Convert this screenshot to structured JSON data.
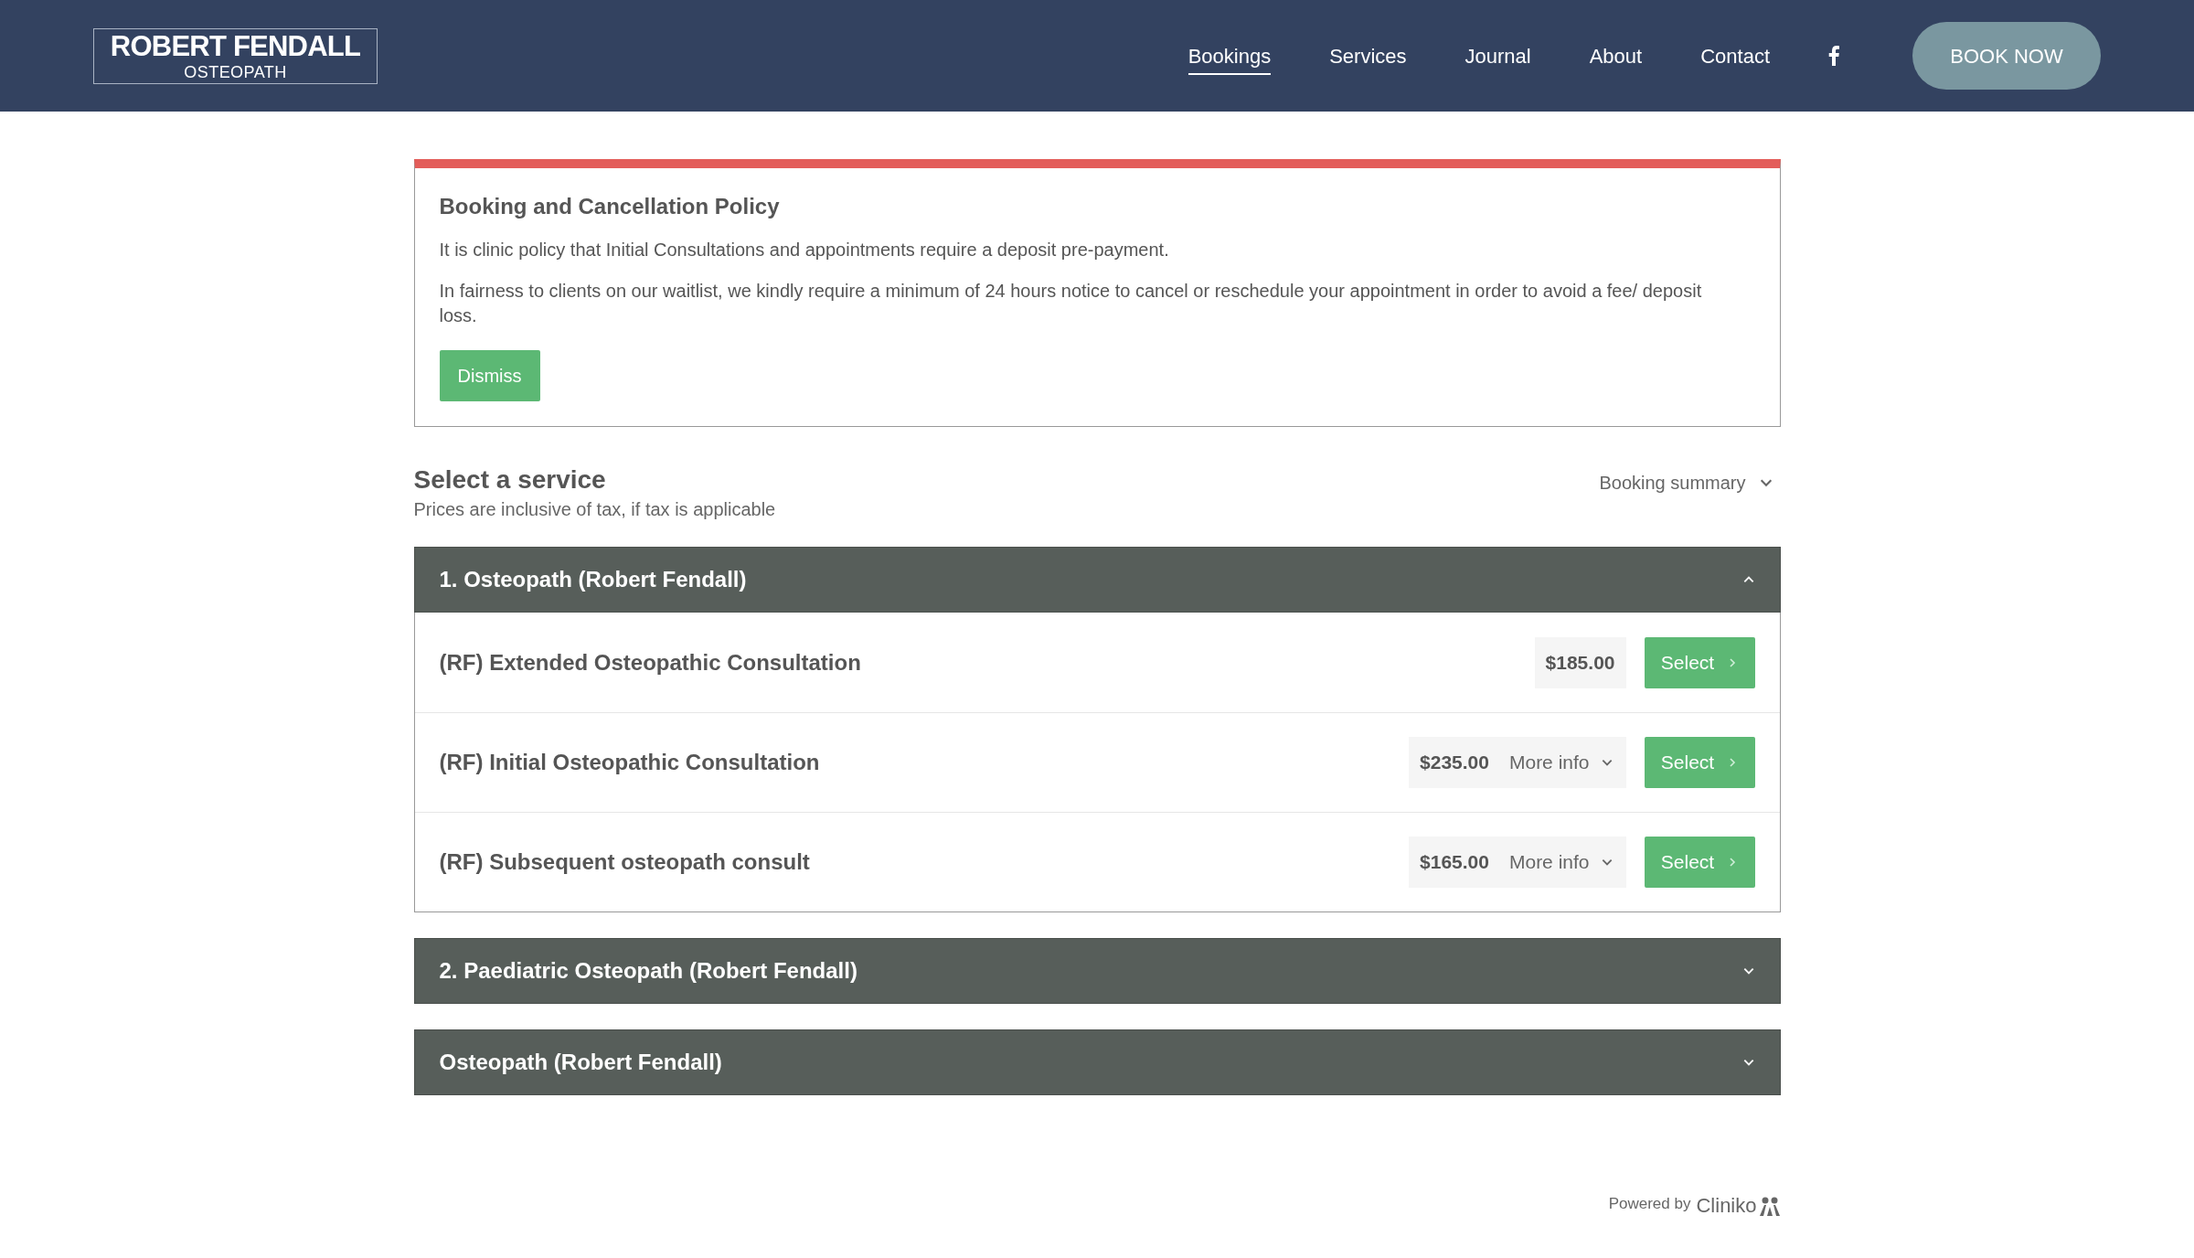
{
  "header": {
    "logo": {
      "name": "ROBERT FENDALL",
      "subtitle": "OSTEOPATH"
    },
    "nav": [
      {
        "label": "Bookings",
        "selected": true
      },
      {
        "label": "Services",
        "selected": false
      },
      {
        "label": "Journal",
        "selected": false
      },
      {
        "label": "About",
        "selected": false
      },
      {
        "label": "Contact",
        "selected": false
      }
    ],
    "book_button": "BOOK NOW"
  },
  "policy": {
    "title": "Booking and Cancellation Policy",
    "paragraphs": [
      "It is clinic policy that Initial Consultations and appointments require a deposit pre-payment.",
      "In fairness to clients on our waitlist, we kindly require a minimum of 24 hours notice to cancel or reschedule your appointment in order to avoid a fee/ deposit loss."
    ],
    "button": "Dismiss"
  },
  "service_picker": {
    "title": "Select a service",
    "subtitle": "Prices are inclusive of tax, if tax is applicable",
    "summary": "Booking summary"
  },
  "groups": [
    {
      "title": "1. Osteopath (Robert Fendall)",
      "expanded": true,
      "services": [
        {
          "name": "(RF) Extended Osteopathic Consultation",
          "price": "$185.00",
          "button": "Select"
        },
        {
          "name": "(RF) Initial Osteopathic Consultation",
          "price": "$235.00",
          "more_info": "More info",
          "button": "Select"
        },
        {
          "name": "(RF) Subsequent osteopath consult",
          "price": "$165.00",
          "more_info": "More info",
          "button": "Select"
        }
      ]
    },
    {
      "title": "2. Paediatric Osteopath (Robert Fendall)",
      "expanded": false
    },
    {
      "title": "Osteopath (Robert Fendall)",
      "expanded": false
    }
  ],
  "footer": {
    "powered_by": "Powered by",
    "brand": "Cliniko"
  }
}
